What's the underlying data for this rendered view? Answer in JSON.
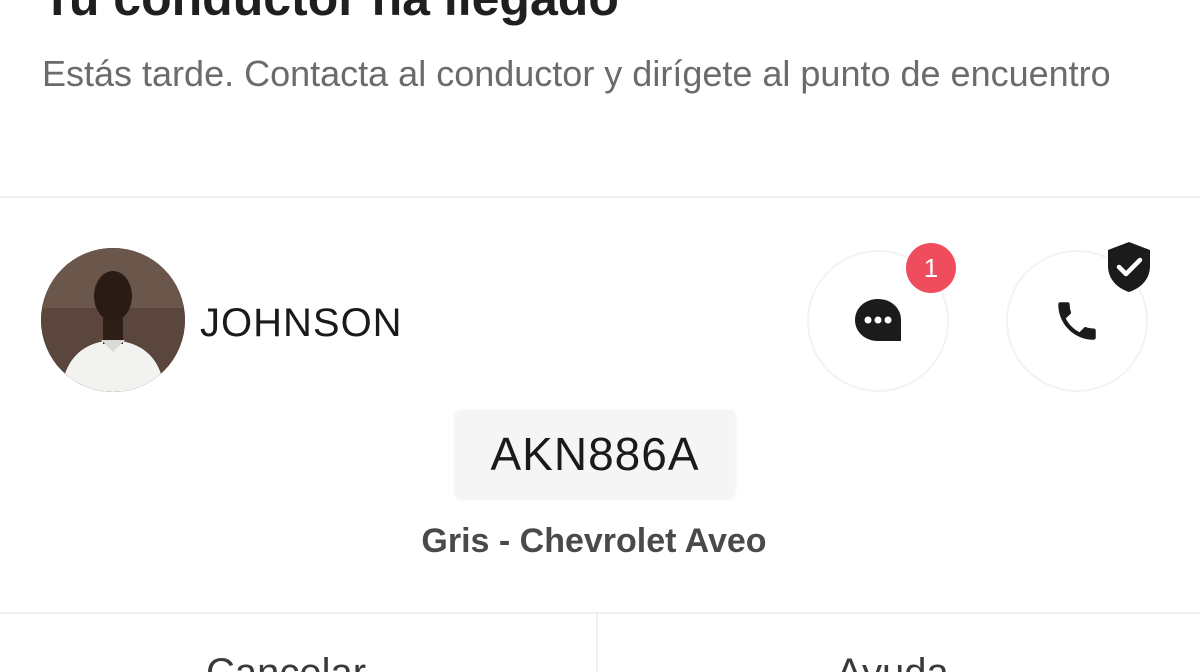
{
  "header": {
    "title": "Tu conductor ha llegado",
    "subtitle": "Estás tarde. Contacta al conductor y dirígete al punto de encuentro"
  },
  "driver": {
    "name": "JOHNSON",
    "avatar_icon": "driver-photo"
  },
  "actions": {
    "chat_icon": "chat-bubble-icon",
    "chat_unread_count": "1",
    "call_icon": "phone-icon",
    "verified_icon": "shield-check-icon"
  },
  "vehicle": {
    "plate": "AKN886A",
    "description": "Gris - Chevrolet Aveo"
  },
  "footer": {
    "left_label": "Cancelar",
    "right_label": "Ayuda"
  },
  "colors": {
    "badge": "#ef4d5d",
    "text_primary": "#1f1f1f",
    "text_secondary": "#6b6b6b"
  }
}
